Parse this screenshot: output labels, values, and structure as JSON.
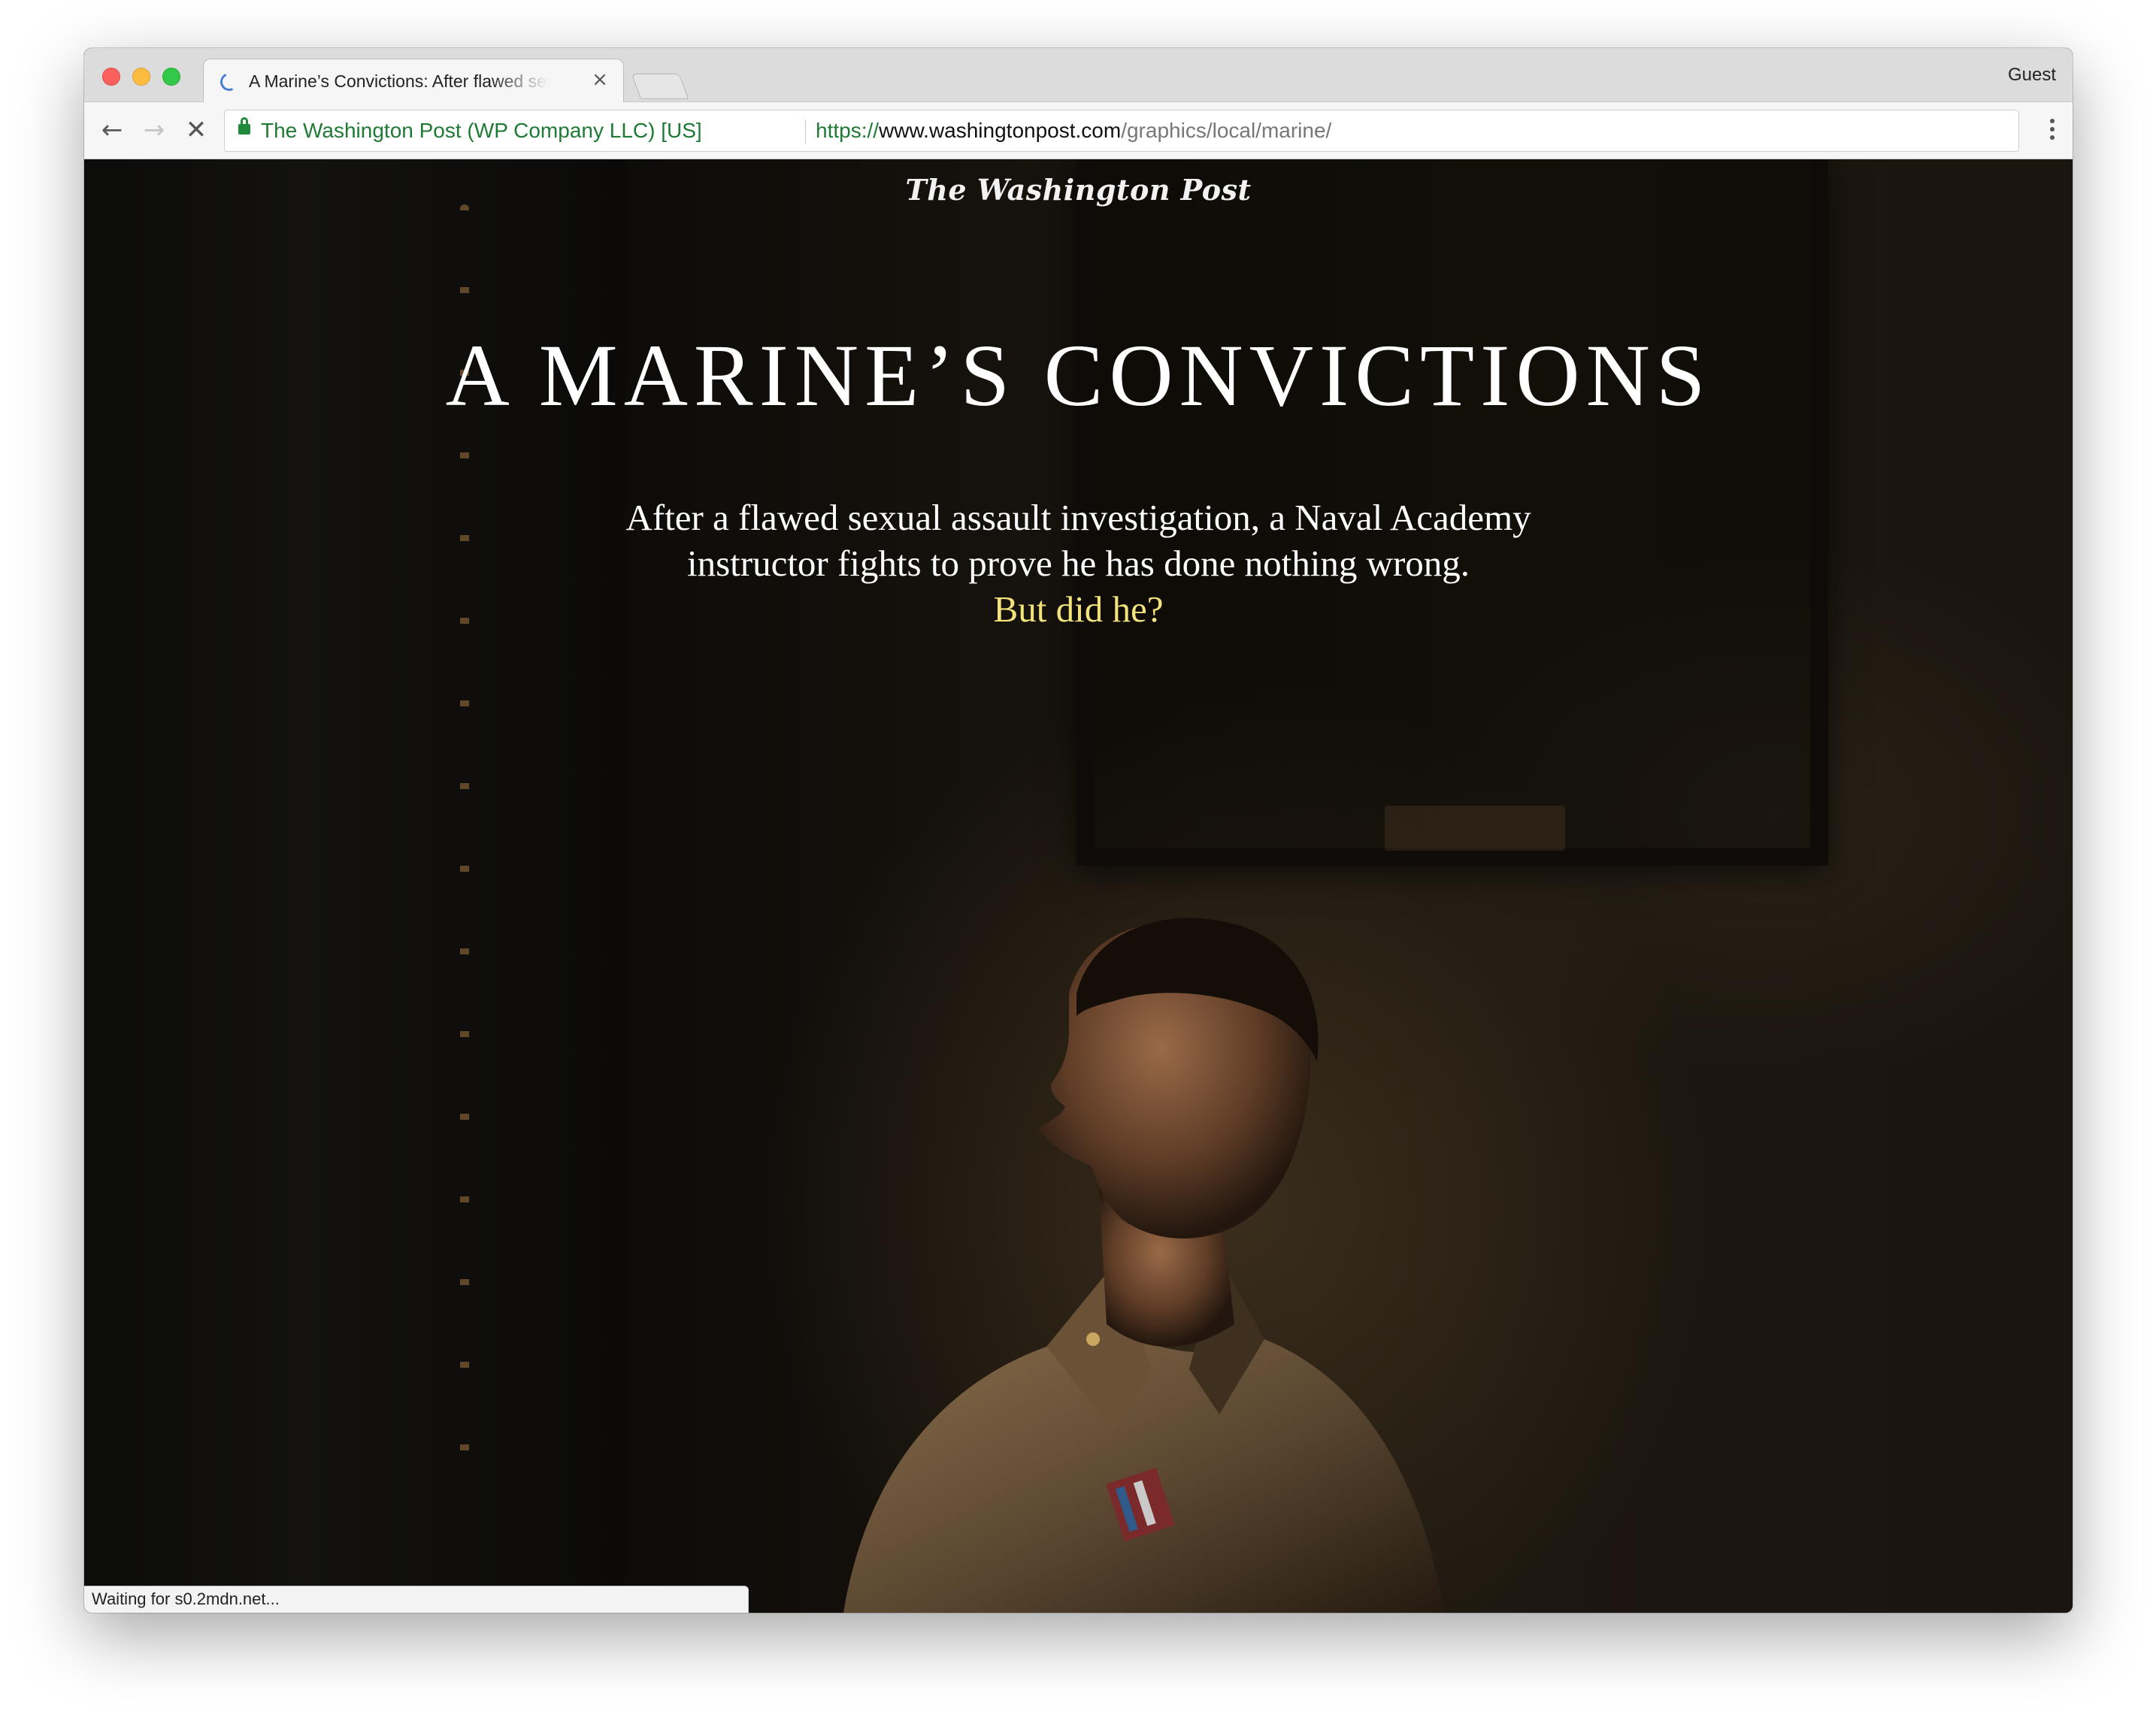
{
  "browser": {
    "tab": {
      "title": "A Marine’s Convictions: After flawed sexual assault investigation",
      "close_icon": "×"
    },
    "profile_label": "Guest",
    "nav": {
      "back_icon": "←",
      "forward_icon": "→",
      "stop_icon": "✕"
    },
    "omnibox": {
      "ev_name": "The Washington Post (WP Company LLC) [US]",
      "url_scheme": "https://",
      "url_host": "www.washingtonpost.com",
      "url_path": "/graphics/local/marine/"
    },
    "status_text": "Waiting for s0.2mdn.net..."
  },
  "article": {
    "logo": "The Washington Post",
    "headline": "A MARINE’S CONVICTIONS",
    "dek_line_1": "After a flawed sexual assault investigation, a Naval Academy",
    "dek_line_2": "instructor fights to prove he has done nothing wrong.",
    "dek_highlight": "But did he?",
    "highlight_color": "#f3e37c"
  }
}
